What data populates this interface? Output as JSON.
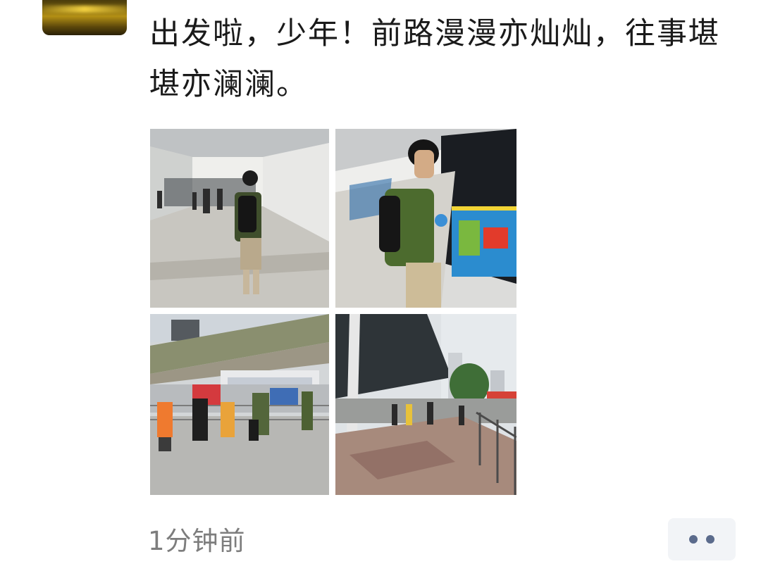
{
  "post": {
    "text": "出发啦，少年！前路漫漫亦灿灿，往事堪堪亦澜澜。",
    "photos": [
      "subway-corridor-photo",
      "subway-platform-photo",
      "street-overpass-photo",
      "station-canopy-photo"
    ],
    "timestamp": "1分钟前"
  },
  "icons": {
    "more": "more-dots-icon"
  },
  "colors": {
    "text": "#1a1a1a",
    "timestamp": "#7d7d7d",
    "more_button_bg": "#f2f4f7",
    "more_dots": "#5b6b8c"
  }
}
